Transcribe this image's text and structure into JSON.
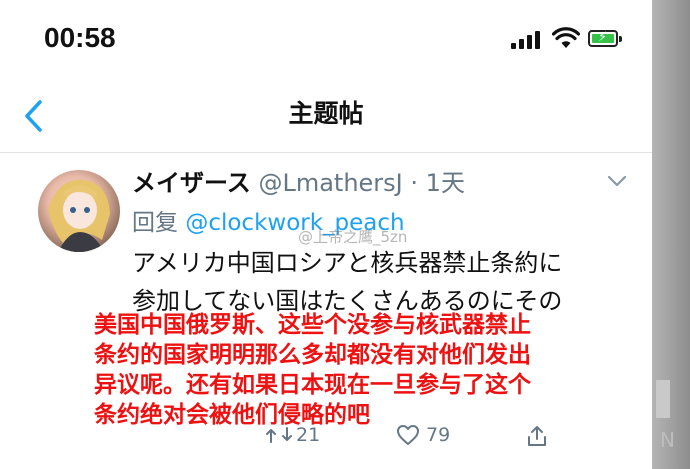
{
  "status_bar": {
    "time": "00:58"
  },
  "nav": {
    "title": "主题帖"
  },
  "tweet": {
    "name": "メイザース",
    "handle": "@LmathersJ",
    "separator": "·",
    "time": "1天",
    "reply_prefix": "回复",
    "reply_mention": "@clockwork_peach",
    "watermark": "@上帝之鹰_5zn",
    "body_lines": [
      "アメリカ中国ロシアと核兵器禁止条約に",
      "参加してない国はたくさんあるのにその"
    ],
    "retweet_count": "21",
    "like_count": "79"
  },
  "caption_lines": [
    "美国中国俄罗斯、这些个没参与核武器禁止",
    "条约的国家明明那么多却都没有对他们发出",
    "异议呢。还有如果日本现在一旦参与了这个",
    "条约绝对会被他们侵略的吧"
  ],
  "colors": {
    "accent": "#1da1f2",
    "caption": "#ee1111",
    "muted": "#657786"
  }
}
